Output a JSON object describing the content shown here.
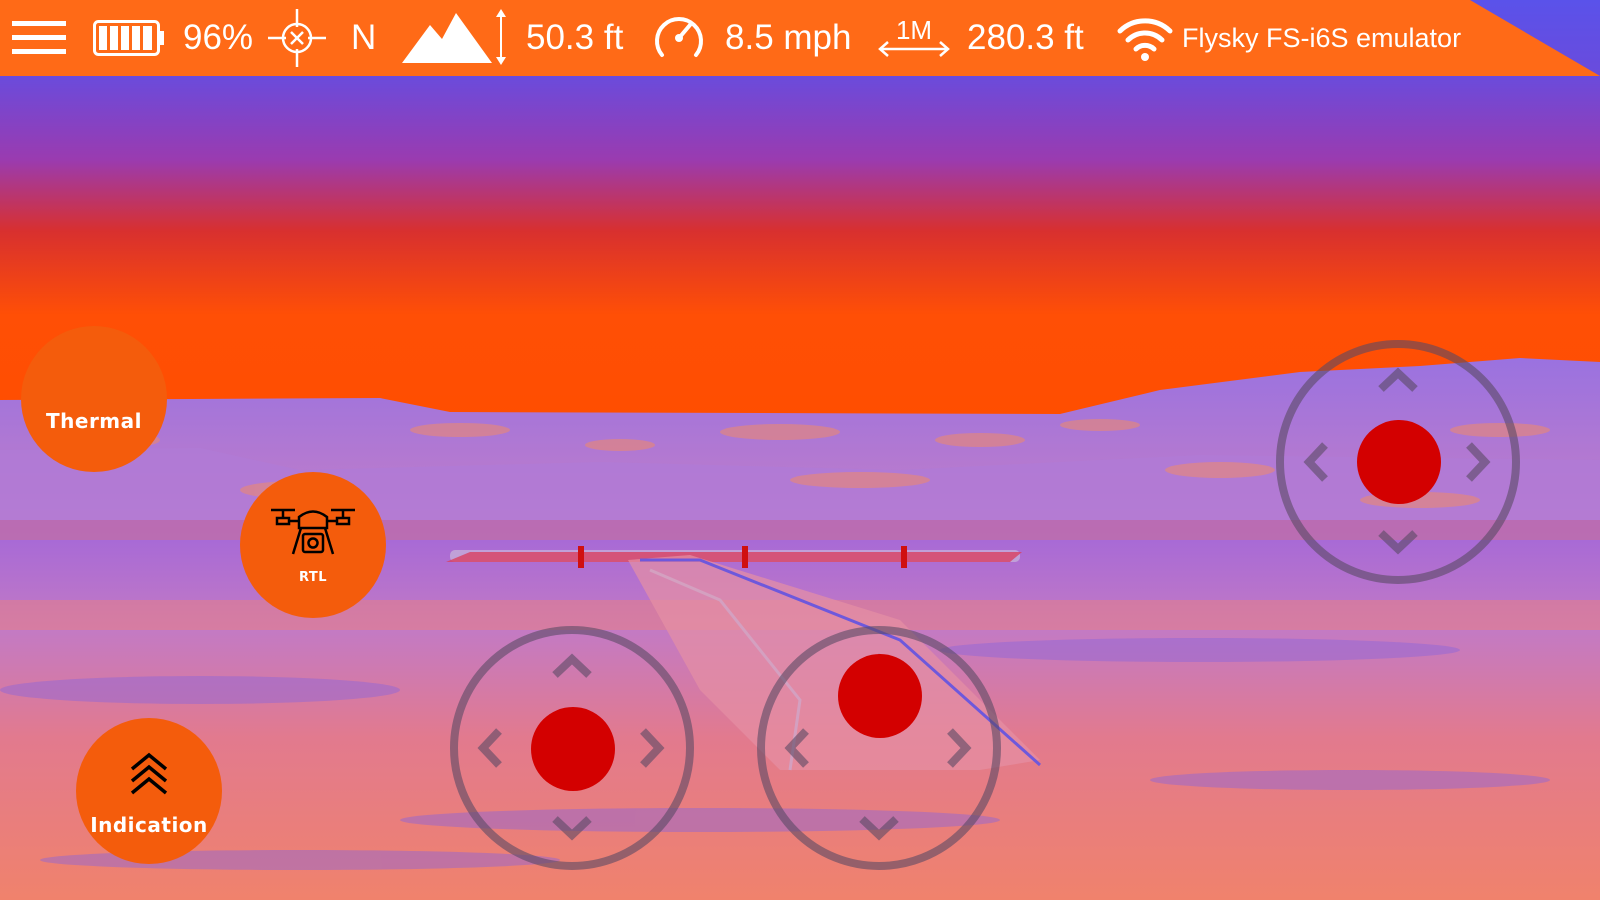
{
  "status_bar": {
    "battery_percent": "96%",
    "battery_level": 0.96,
    "heading": "N",
    "altitude": "50.3 ft",
    "speed": "8.5 mph",
    "distance_scale": "1M",
    "distance": "280.3 ft",
    "controller_name": "Flysky FS-i6S emulator"
  },
  "icons": {
    "menu": "hamburger-menu-icon",
    "battery": "battery-icon",
    "gps": "gps-crosshair-icon",
    "altitude": "mountain-altitude-icon",
    "speed": "speedometer-icon",
    "distance": "distance-arrow-icon",
    "signal": "wifi-signal-icon",
    "drone": "drone-icon",
    "chevrons": "double-chevron-up-icon"
  },
  "buttons": {
    "thermal": "Thermal",
    "rtl": "RTL",
    "indication": "Indication"
  },
  "colors": {
    "bar": "#ff6a17",
    "button": "#f45c0c",
    "knob": "#d30000"
  }
}
